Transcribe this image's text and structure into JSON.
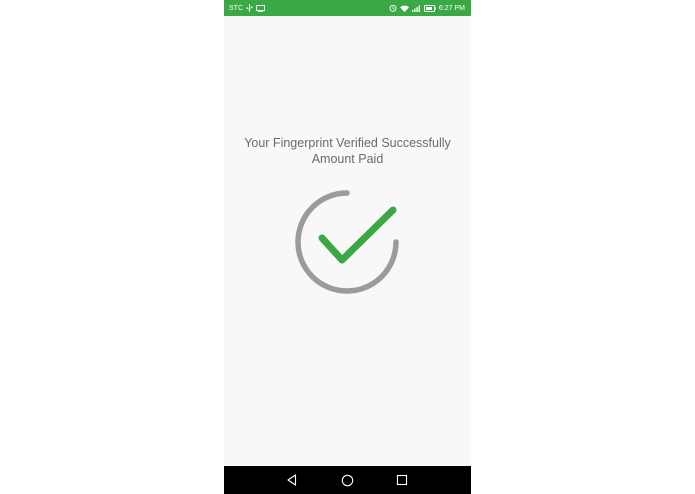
{
  "status_bar": {
    "carrier": "STC",
    "time": "6:27 PM",
    "background_color": "#3aa845",
    "left_icons": [
      "usb-icon",
      "cast-icon"
    ],
    "right_icons": [
      "alarm-icon",
      "wifi-icon",
      "signal-icon",
      "battery-icon"
    ]
  },
  "main": {
    "message_line1": "Your Fingerprint Verified Successfully",
    "message_line2": "Amount Paid",
    "success_icon": "checkmark-circle-icon",
    "check_color": "#3aa845",
    "ring_color": "#9b9b9b"
  },
  "nav_bar": {
    "buttons": [
      "back-icon",
      "home-icon",
      "recents-icon"
    ]
  }
}
